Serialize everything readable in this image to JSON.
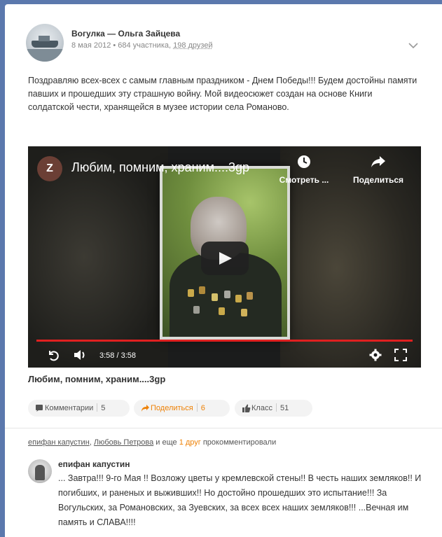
{
  "post": {
    "author": "Вогулка — Ольга Зайцева",
    "meta_date": "8 мая 2012 • 684 участника, ",
    "meta_friends": "198 друзей",
    "text": "Поздравляю всех-всех с самым главным праздником - Днем Победы!!! Будем достойны памяти павших и прошедших эту страшную войну. Мой видеосюжет создан на основе Книги солдатской чести, хранящейся в музее истории села Романово."
  },
  "video": {
    "channel_initial": "Z",
    "title": "Любим, помним, храним....3gp",
    "watch_label": "Смотреть ...",
    "share_label": "Поделиться",
    "time": "3:58 / 3:58",
    "progress": 1.0,
    "caption": "Любим, помним, храним....3gp"
  },
  "actions": {
    "comments_label": "Комментарии",
    "comments_count": "5",
    "share_label": "Поделиться",
    "share_count": "6",
    "like_label": "Класс",
    "like_count": "51"
  },
  "comments": {
    "summary_user1": "епифан капустин",
    "summary_sep": ", ",
    "summary_user2": "Любовь Петрова",
    "summary_and": " и еще ",
    "summary_more": "1 друг",
    "summary_tail": " прокомментировали",
    "author": "епифан капустин",
    "text": "... Завтра!!! 9-го Мая !! Возложу цветы у кремлевской стены!! В честь наших земляков!! И погибших, и раненых и выживших!! Но достойно прошедших это испытание!!! За Вогульских, за Романовских, за Зуевских, за всех всех наших земляков!!! ...Вечная им память и СЛАВА!!!!"
  },
  "colors": {
    "page_bg": "#5b78ad",
    "accent_orange": "#ee8208",
    "progress_red": "#e02020"
  }
}
